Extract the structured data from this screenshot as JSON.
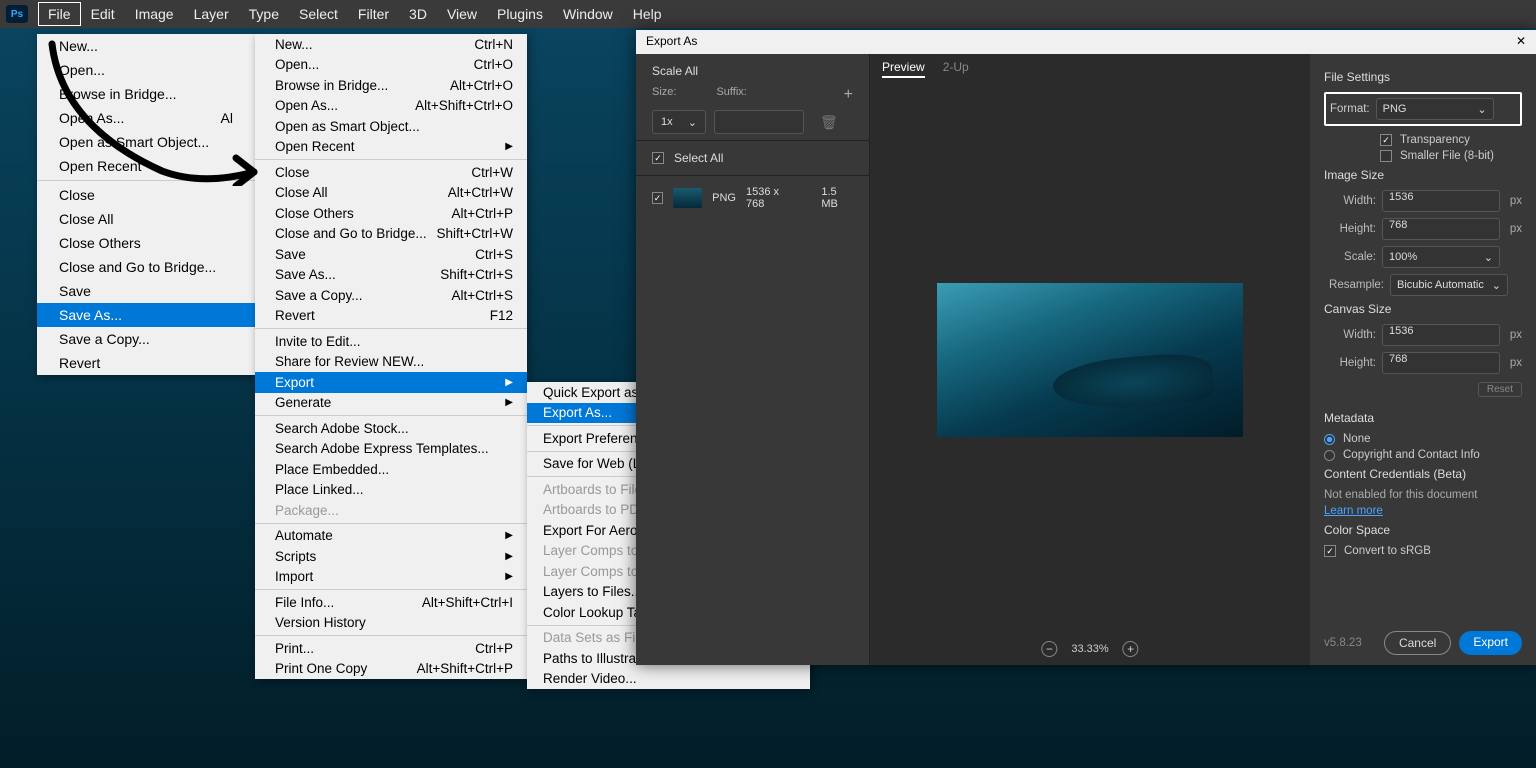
{
  "menubar": [
    "File",
    "Edit",
    "Image",
    "Layer",
    "Type",
    "Select",
    "Filter",
    "3D",
    "View",
    "Plugins",
    "Window",
    "Help"
  ],
  "ps_logo": "Ps",
  "file_menu1": [
    {
      "label": "New..."
    },
    {
      "label": "Open..."
    },
    {
      "label": "Browse in Bridge..."
    },
    {
      "label": "Open As...",
      "shortcut": "Al"
    },
    {
      "label": "Open as Smart Object..."
    },
    {
      "label": "Open Recent"
    },
    {
      "sep": true
    },
    {
      "label": "Close"
    },
    {
      "label": "Close All"
    },
    {
      "label": "Close Others"
    },
    {
      "label": "Close and Go to Bridge..."
    },
    {
      "label": "Save"
    },
    {
      "label": "Save As...",
      "hl": true
    },
    {
      "label": "Save a Copy..."
    },
    {
      "label": "Revert"
    }
  ],
  "file_menu2": [
    {
      "label": "New...",
      "shortcut": "Ctrl+N"
    },
    {
      "label": "Open...",
      "shortcut": "Ctrl+O"
    },
    {
      "label": "Browse in Bridge...",
      "shortcut": "Alt+Ctrl+O"
    },
    {
      "label": "Open As...",
      "shortcut": "Alt+Shift+Ctrl+O"
    },
    {
      "label": "Open as Smart Object..."
    },
    {
      "label": "Open Recent",
      "sub": true
    },
    {
      "sep": true
    },
    {
      "label": "Close",
      "shortcut": "Ctrl+W"
    },
    {
      "label": "Close All",
      "shortcut": "Alt+Ctrl+W"
    },
    {
      "label": "Close Others",
      "shortcut": "Alt+Ctrl+P"
    },
    {
      "label": "Close and Go to Bridge...",
      "shortcut": "Shift+Ctrl+W"
    },
    {
      "label": "Save",
      "shortcut": "Ctrl+S"
    },
    {
      "label": "Save As...",
      "shortcut": "Shift+Ctrl+S"
    },
    {
      "label": "Save a Copy...",
      "shortcut": "Alt+Ctrl+S"
    },
    {
      "label": "Revert",
      "shortcut": "F12"
    },
    {
      "sep": true
    },
    {
      "label": "Invite to Edit..."
    },
    {
      "label": "Share for Review NEW..."
    },
    {
      "label": "Export",
      "sub": true,
      "hl": true
    },
    {
      "label": "Generate",
      "sub": true
    },
    {
      "sep": true
    },
    {
      "label": "Search Adobe Stock..."
    },
    {
      "label": "Search Adobe Express Templates..."
    },
    {
      "label": "Place Embedded..."
    },
    {
      "label": "Place Linked..."
    },
    {
      "label": "Package...",
      "dis": true
    },
    {
      "sep": true
    },
    {
      "label": "Automate",
      "sub": true
    },
    {
      "label": "Scripts",
      "sub": true
    },
    {
      "label": "Import",
      "sub": true
    },
    {
      "sep": true
    },
    {
      "label": "File Info...",
      "shortcut": "Alt+Shift+Ctrl+I"
    },
    {
      "label": "Version History"
    },
    {
      "sep": true
    },
    {
      "label": "Print...",
      "shortcut": "Ctrl+P"
    },
    {
      "label": "Print One Copy",
      "shortcut": "Alt+Shift+Ctrl+P"
    }
  ],
  "export_menu": [
    {
      "label": "Quick Export as"
    },
    {
      "label": "Export As...",
      "hl": true
    },
    {
      "sep": true
    },
    {
      "label": "Export Preferenc"
    },
    {
      "sep": true
    },
    {
      "label": "Save for Web (Le"
    },
    {
      "sep": true
    },
    {
      "label": "Artboards to File",
      "dis": true
    },
    {
      "label": "Artboards to PD",
      "dis": true
    },
    {
      "label": "Export For Aero."
    },
    {
      "label": "Layer Comps to",
      "dis": true
    },
    {
      "label": "Layer Comps to",
      "dis": true
    },
    {
      "label": "Layers to Files..."
    },
    {
      "label": "Color Lookup Ta"
    },
    {
      "sep": true
    },
    {
      "label": "Data Sets as Files",
      "dis": true
    },
    {
      "label": "Paths to Illustrator..."
    },
    {
      "label": "Render Video..."
    }
  ],
  "export_dialog": {
    "title": "Export As",
    "close": "✕",
    "left": {
      "scale_all": "Scale All",
      "size_label": "Size:",
      "suffix_label": "Suffix:",
      "scale_value": "1x",
      "select_all": "Select All",
      "asset_format": "PNG",
      "asset_dim": "1536 x 768",
      "asset_size": "1.5 MB"
    },
    "tabs": {
      "preview": "Preview",
      "twoup": "2-Up"
    },
    "zoom": "33.33%",
    "right": {
      "file_settings": "File Settings",
      "format_label": "Format:",
      "format_value": "PNG",
      "transparency": "Transparency",
      "smaller": "Smaller File (8-bit)",
      "image_size": "Image Size",
      "width_label": "Width:",
      "width_val": "1536",
      "height_label": "Height:",
      "height_val": "768",
      "scale_label": "Scale:",
      "scale_val": "100%",
      "resample_label": "Resample:",
      "resample_val": "Bicubic Automatic",
      "canvas_size": "Canvas Size",
      "cwidth": "1536",
      "cheight": "768",
      "px": "px",
      "reset": "Reset",
      "metadata": "Metadata",
      "meta_none": "None",
      "meta_copy": "Copyright and Contact Info",
      "cc_beta": "Content Credentials (Beta)",
      "cc_msg": "Not enabled for this document",
      "learn": "Learn more",
      "color_space": "Color Space",
      "srgb": "Convert to sRGB",
      "version": "v5.8.23",
      "cancel": "Cancel",
      "export": "Export"
    }
  }
}
